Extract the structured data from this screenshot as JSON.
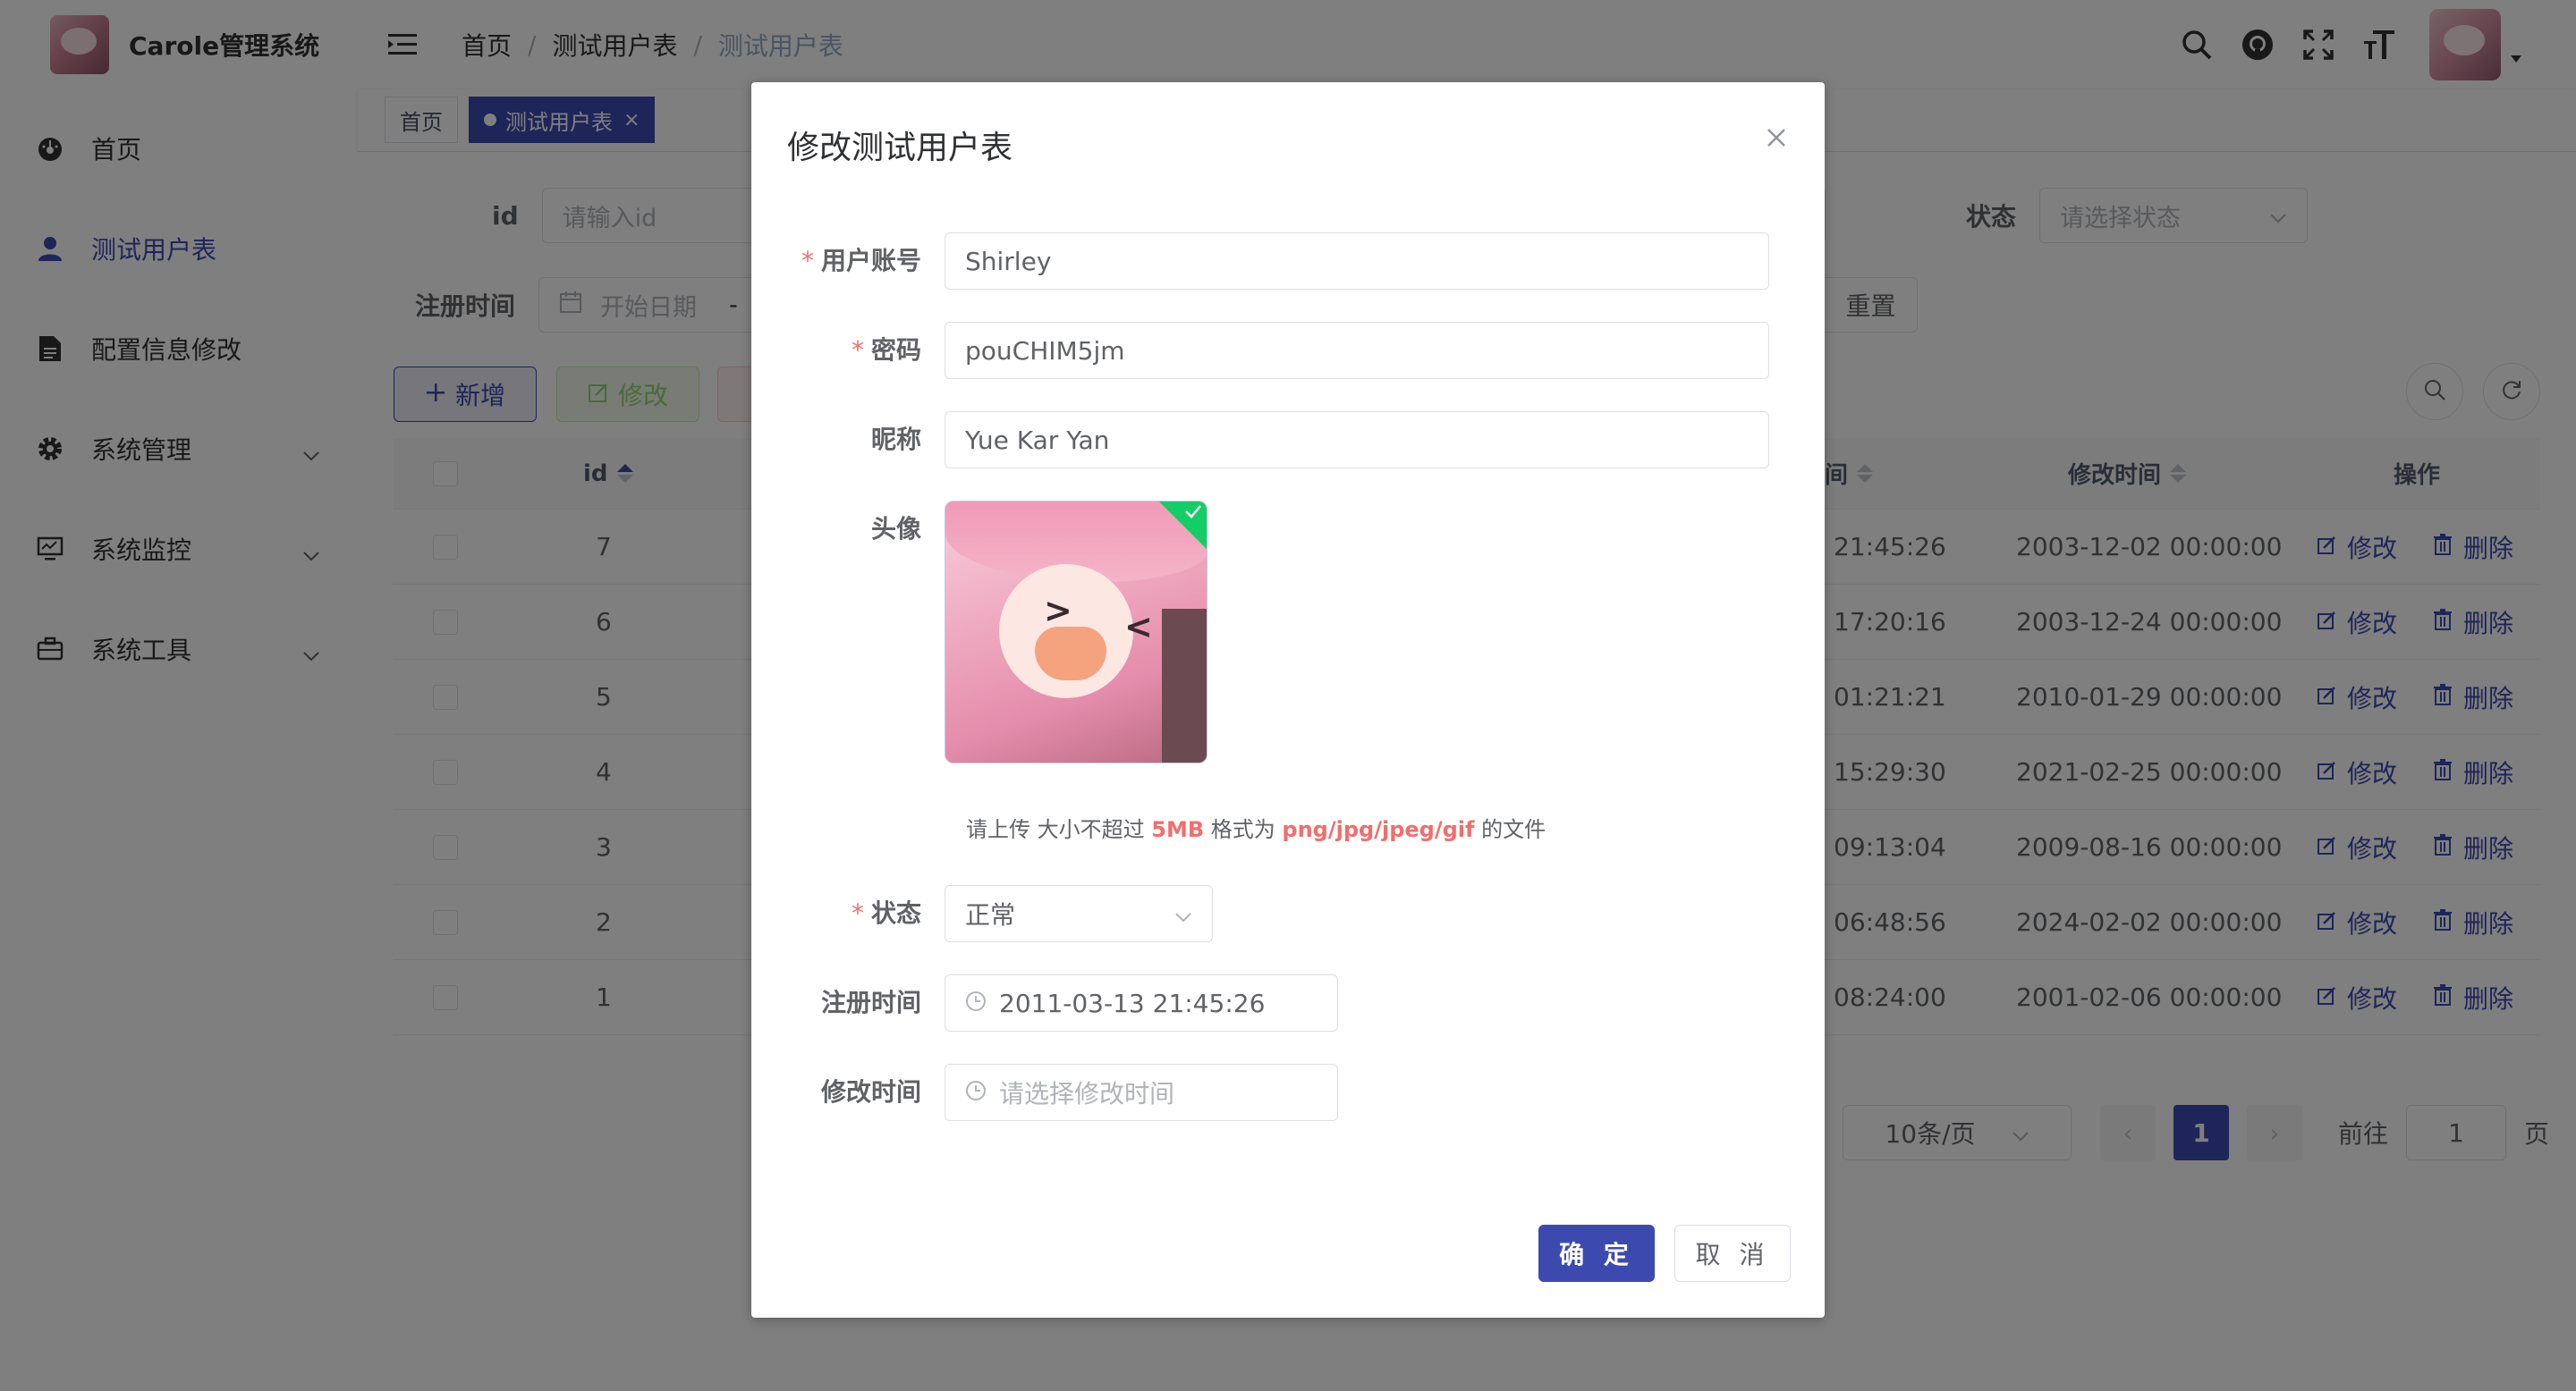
{
  "app": {
    "title": "Carole管理系统"
  },
  "sidebar": {
    "items": [
      {
        "label": "首页",
        "icon": "dashboard-icon"
      },
      {
        "label": "测试用户表",
        "icon": "user-icon",
        "active": true
      },
      {
        "label": "配置信息修改",
        "icon": "document-icon"
      },
      {
        "label": "系统管理",
        "icon": "gear-icon",
        "expandable": true
      },
      {
        "label": "系统监控",
        "icon": "monitor-icon",
        "expandable": true
      },
      {
        "label": "系统工具",
        "icon": "toolbox-icon",
        "expandable": true
      }
    ]
  },
  "header": {
    "breadcrumb": [
      "首页",
      "测试用户表",
      "测试用户表"
    ],
    "separator": "/",
    "tools": [
      "search-icon",
      "github-icon",
      "fullscreen-icon",
      "font-size-icon"
    ]
  },
  "tags": {
    "home": "首页",
    "active": "测试用户表"
  },
  "search": {
    "id_label": "id",
    "id_placeholder": "请输入id",
    "status_label": "状态",
    "status_placeholder": "请选择状态",
    "reg_time_label": "注册时间",
    "start_placeholder": "开始日期",
    "range_sep": "-",
    "reset_label": "重置"
  },
  "toolbar": {
    "add_label": "新增",
    "edit_label": "修改"
  },
  "table": {
    "headers": {
      "id": "id",
      "reg_time_partial": "间",
      "mod_time": "修改时间",
      "ops": "操作"
    },
    "rows": [
      {
        "id": "7",
        "reg": "21:45:26",
        "mod": "2003-12-02 00:00:00"
      },
      {
        "id": "6",
        "reg": "17:20:16",
        "mod": "2003-12-24 00:00:00"
      },
      {
        "id": "5",
        "reg": "01:21:21",
        "mod": "2010-01-29 00:00:00"
      },
      {
        "id": "4",
        "reg": "15:29:30",
        "mod": "2021-02-25 00:00:00"
      },
      {
        "id": "3",
        "reg": "09:13:04",
        "mod": "2009-08-16 00:00:00"
      },
      {
        "id": "2",
        "reg": "06:48:56",
        "mod": "2024-02-02 00:00:00"
      },
      {
        "id": "1",
        "reg": "08:24:00",
        "mod": "2001-02-06 00:00:00"
      }
    ],
    "edit_label": "修改",
    "delete_label": "删除"
  },
  "pagination": {
    "page_size": "10条/页",
    "current": "1",
    "goto_label": "前往",
    "goto_value": "1",
    "page_suffix": "页"
  },
  "dialog": {
    "title": "修改测试用户表",
    "fields": {
      "account_label": "用户账号",
      "account_value": "Shirley",
      "password_label": "密码",
      "password_value": "pouCHIM5jm",
      "nickname_label": "昵称",
      "nickname_value": "Yue Kar Yan",
      "avatar_label": "头像",
      "status_label": "状态",
      "status_value": "正常",
      "reg_time_label": "注册时间",
      "reg_time_value": "2011-03-13 21:45:26",
      "mod_time_label": "修改时间",
      "mod_time_placeholder": "请选择修改时间"
    },
    "upload_tip": {
      "prefix": "请上传 大小不超过 ",
      "size": "5MB",
      "middle": " 格式为 ",
      "formats": "png/jpg/jpeg/gif",
      "suffix": " 的文件"
    },
    "confirm_label": "确 定",
    "cancel_label": "取 消",
    "required_mark": "*"
  },
  "colors": {
    "primary": "#3c4ab0",
    "danger": "#f56c6c",
    "success": "#13ce66"
  }
}
